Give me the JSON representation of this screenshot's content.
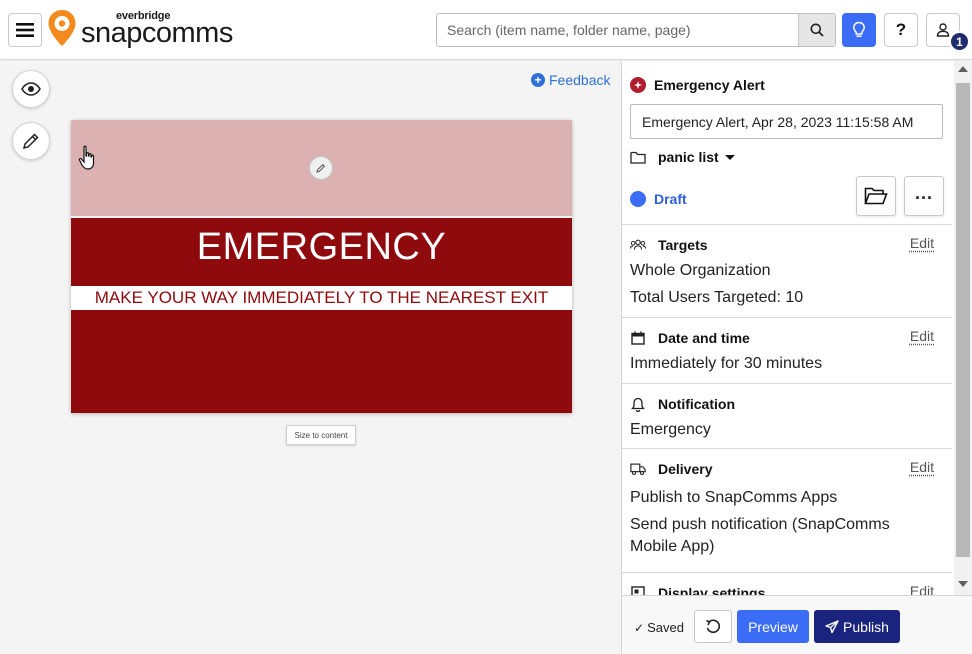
{
  "header": {
    "logo_brand": "everbridge",
    "logo_product": "snapcomms",
    "search_placeholder": "Search (item name, folder name, page)",
    "help_label": "?",
    "notification_count": "1"
  },
  "canvas": {
    "feedback_label": "Feedback",
    "alert_title": "EMERGENCY",
    "alert_subtitle": "MAKE YOUR WAY IMMEDIATELY TO THE NEAREST EXIT",
    "size_to_content_label": "Size to content",
    "colors": {
      "top_band": "#dbb1b1",
      "main_band": "#8e0a0d"
    }
  },
  "panel": {
    "item_type": "Emergency Alert",
    "item_name": "Emergency Alert, Apr 28, 2023 11:15:58 AM",
    "folder": "panic list",
    "status": "Draft",
    "sections": {
      "targets": {
        "title": "Targets",
        "edit": "Edit",
        "line1": "Whole Organization",
        "line2": "Total Users Targeted: 10"
      },
      "datetime": {
        "title": "Date and time",
        "edit": "Edit",
        "line1": "Immediately for 30 minutes"
      },
      "notification": {
        "title": "Notification",
        "line1": "Emergency"
      },
      "delivery": {
        "title": "Delivery",
        "edit": "Edit",
        "line1": "Publish to SnapComms Apps",
        "line2": "Send push notification (SnapComms Mobile App)"
      },
      "display": {
        "title": "Display settings",
        "edit": "Edit"
      }
    }
  },
  "footer": {
    "saved_label": "Saved",
    "preview_label": "Preview",
    "publish_label": "Publish"
  }
}
